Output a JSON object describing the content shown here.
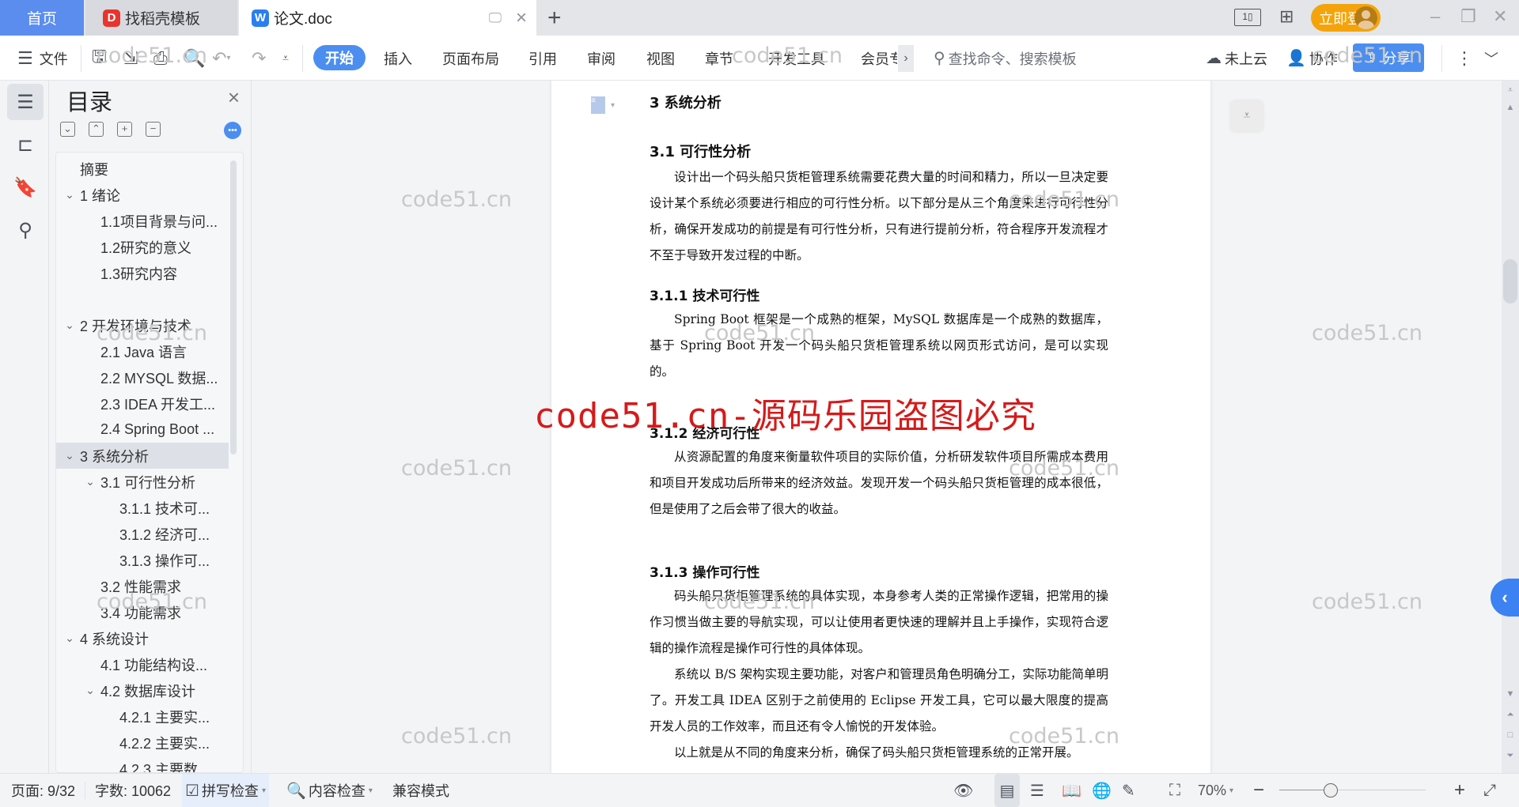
{
  "tabs": {
    "home": "首页",
    "template": "找稻壳模板",
    "template_icon": "D",
    "document": "论文.doc",
    "document_icon": "W",
    "new_tab": "+"
  },
  "titlebar": {
    "login": "立即登录",
    "minimize": "–",
    "restore": "❐",
    "close": "✕"
  },
  "toolbar": {
    "menu": "文件",
    "ribbon_tabs": [
      "开始",
      "插入",
      "页面布局",
      "引用",
      "审阅",
      "视图",
      "章节",
      "开发工具",
      "会员专"
    ],
    "more": "›",
    "search_placeholder": "查找命令、搜索模板",
    "cloud": "未上云",
    "collab": "协作",
    "share": "分享"
  },
  "toc": {
    "title": "目录",
    "items": [
      {
        "label": "摘要",
        "level": 0,
        "expanded": null
      },
      {
        "label": "1 绪论",
        "level": 0,
        "expanded": true
      },
      {
        "label": "1.1项目背景与问...",
        "level": 1,
        "expanded": null
      },
      {
        "label": "1.2研究的意义",
        "level": 1,
        "expanded": null
      },
      {
        "label": "1.3研究内容",
        "level": 1,
        "expanded": null
      },
      {
        "label": "",
        "level": 1,
        "expanded": null
      },
      {
        "label": "2 开发环境与技术",
        "level": 0,
        "expanded": true
      },
      {
        "label": "2.1 Java 语言",
        "level": 1,
        "expanded": null
      },
      {
        "label": "2.2 MYSQL 数据...",
        "level": 1,
        "expanded": null
      },
      {
        "label": "2.3 IDEA 开发工...",
        "level": 1,
        "expanded": null
      },
      {
        "label": "2.4 Spring Boot ...",
        "level": 1,
        "expanded": null
      },
      {
        "label": "3  系统分析",
        "level": 0,
        "expanded": true,
        "selected": true
      },
      {
        "label": "3.1  可行性分析",
        "level": 1,
        "expanded": true
      },
      {
        "label": "3.1.1  技术可...",
        "level": 2,
        "expanded": null
      },
      {
        "label": "3.1.2  经济可...",
        "level": 2,
        "expanded": null
      },
      {
        "label": "3.1.3  操作可...",
        "level": 2,
        "expanded": null
      },
      {
        "label": "3.2  性能需求",
        "level": 1,
        "expanded": null
      },
      {
        "label": "3.4  功能需求",
        "level": 1,
        "expanded": null
      },
      {
        "label": "4  系统设计",
        "level": 0,
        "expanded": true
      },
      {
        "label": "4.1  功能结构设...",
        "level": 1,
        "expanded": null
      },
      {
        "label": "4.2  数据库设计",
        "level": 1,
        "expanded": true
      },
      {
        "label": "4.2.1  主要实...",
        "level": 2,
        "expanded": null
      },
      {
        "label": "4.2.2  主要实...",
        "level": 2,
        "expanded": null
      },
      {
        "label": "4.2.3  主要数...",
        "level": 2,
        "expanded": null
      }
    ]
  },
  "document": {
    "h_chapter": "3  系统分析",
    "h_31": "3.1  可行性分析",
    "p_31": "设计出一个码头船只货柜管理系统需要花费大量的时间和精力，所以一旦决定要设计某个系统必须要进行相应的可行性分析。以下部分是从三个角度来进行可行性分析，确保开发成功的前提是有可行性分析，只有进行提前分析，符合程序开发流程才不至于导致开发过程的中断。",
    "h_311": "3.1.1  技术可行性",
    "p_311": "Spring Boot 框架是一个成熟的框架，MySQL 数据库是一个成熟的数据库，基于 Spring Boot 开发一个码头船只货柜管理系统以网页形式访问，是可以实现的。",
    "h_312": "3.1.2  经济可行性",
    "p_312": "从资源配置的角度来衡量软件项目的实际价值，分析研发软件项目所需成本费用和项目开发成功后所带来的经济效益。发现开发一个码头船只货柜管理的成本很低，但是使用了之后会带了很大的收益。",
    "h_313": "3.1.3  操作可行性",
    "p_313a": "码头船只货柜管理系统的具体实现，本身参考人类的正常操作逻辑，把常用的操作习惯当做主要的导航实现，可以让使用者更快速的理解并且上手操作，实现符合逻辑的操作流程是操作可行性的具体体现。",
    "p_313b": "系统以 B/S 架构实现主要功能，对客户和管理员角色明确分工，实际功能简单明了。开发工具 IDEA 区别于之前使用的 Eclipse 开发工具，它可以最大限度的提高开发人员的工作效率，而且还有令人愉悦的开发体验。",
    "p_313c": "以上就是从不同的角度来分析，确保了码头船只货柜管理系统的正常开展。"
  },
  "watermarks": {
    "small": "code51.cn",
    "big": "code51.cn-源码乐园盗图必究"
  },
  "status": {
    "page": "页面: 9/32",
    "words": "字数: 10062",
    "spell": "拼写检查",
    "content_check": "内容检查",
    "compat": "兼容模式",
    "zoom": "70%",
    "zoom_level_percent": 70
  },
  "colors": {
    "accent": "#4b8ef0",
    "login": "#f4a40a",
    "watermark_red": "#d51a1a"
  }
}
